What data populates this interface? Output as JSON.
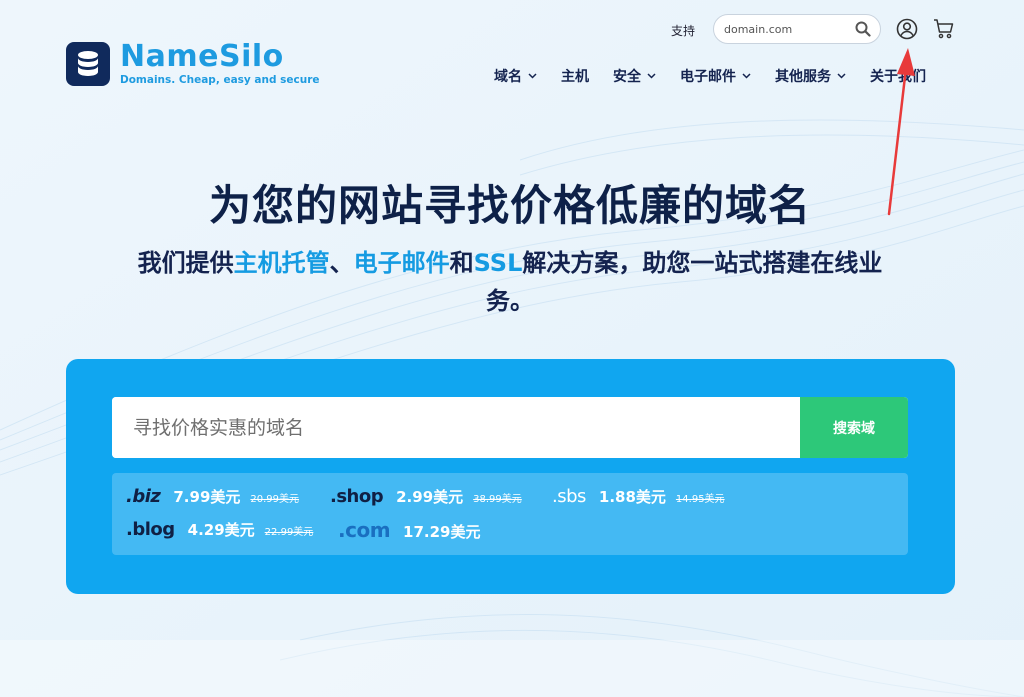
{
  "brand": {
    "name": "NameSilo",
    "tagline": "Domains. Cheap, easy and secure"
  },
  "topbar": {
    "support_label": "支持",
    "search_placeholder": "domain.com"
  },
  "nav": [
    {
      "label": "域名",
      "dropdown": true
    },
    {
      "label": "主机",
      "dropdown": false
    },
    {
      "label": "安全",
      "dropdown": true
    },
    {
      "label": "电子邮件",
      "dropdown": true
    },
    {
      "label": "其他服务",
      "dropdown": true
    },
    {
      "label": "关于我们",
      "dropdown": false
    }
  ],
  "hero": {
    "title": "为您的网站寻找价格低廉的域名",
    "sub_1": "我们提供",
    "sub_hl_1": "主机托管",
    "sub_2": "、",
    "sub_hl_2": "电子邮件",
    "sub_3": "和",
    "sub_hl_3": "SSL",
    "sub_4": "解决方案，助您一站式搭建在线业务。"
  },
  "domain_search": {
    "placeholder": "寻找价格实惠的域名",
    "button_label": "搜索域"
  },
  "tld_prices": [
    {
      "tld": ".biz",
      "price": "7.99美元",
      "old_price": "20.99美元"
    },
    {
      "tld": ".shop",
      "price": "2.99美元",
      "old_price": "38.99美元"
    },
    {
      "tld": ".sbs",
      "price": "1.88美元",
      "old_price": "14.95美元"
    },
    {
      "tld": ".blog",
      "price": "4.29美元",
      "old_price": "22.99美元"
    },
    {
      "tld": ".com",
      "price": "17.29美元",
      "old_price": ""
    }
  ],
  "icons": {
    "support_search": "search-icon",
    "account": "user-circle-icon",
    "cart": "cart-icon",
    "annotation": "red-arrow-icon"
  },
  "colors": {
    "brand_blue": "#1e9be0",
    "panel_blue": "#10a6f0",
    "search_green": "#2dc879",
    "title_navy": "#0e2148",
    "annotation_red": "#e83a3a"
  }
}
